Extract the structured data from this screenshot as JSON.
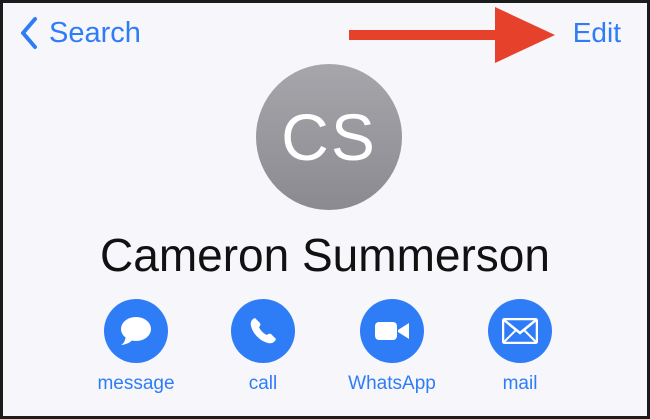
{
  "nav": {
    "back_label": "Search",
    "edit_label": "Edit"
  },
  "contact": {
    "initials": "CS",
    "name": "Cameron Summerson"
  },
  "actions": [
    {
      "label": "message",
      "icon": "message-bubble-icon"
    },
    {
      "label": "call",
      "icon": "phone-icon"
    },
    {
      "label": "WhatsApp",
      "icon": "video-camera-icon"
    },
    {
      "label": "mail",
      "icon": "envelope-icon"
    }
  ],
  "colors": {
    "accent": "#2f7df6",
    "arrow": "#e5412b",
    "avatar": "#8e8e93",
    "background": "#f6f6fb"
  }
}
